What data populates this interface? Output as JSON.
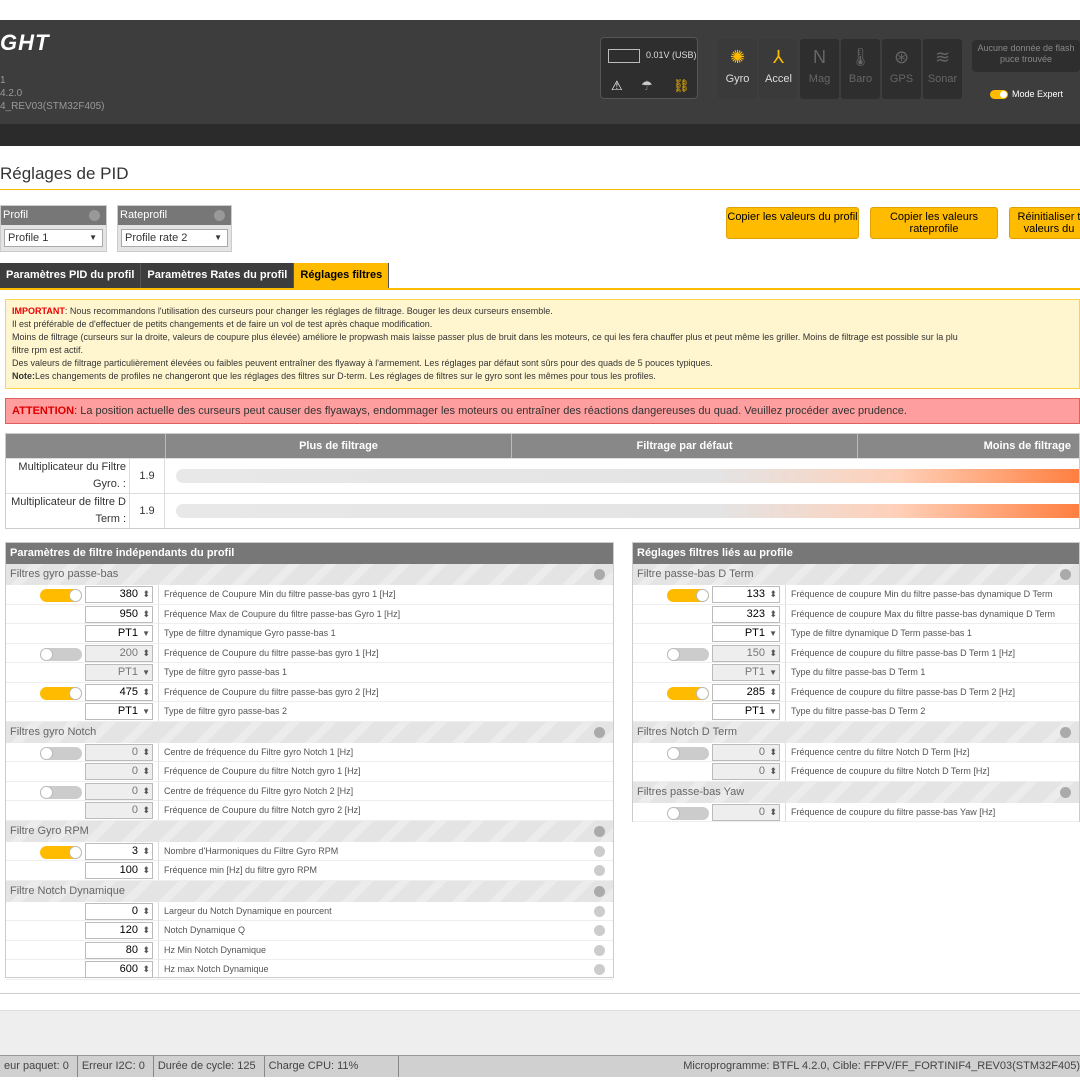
{
  "header": {
    "logo": "GHT",
    "fw_lines": [
      "1",
      "4.2.0",
      "4_REV03(STM32F405)"
    ],
    "battery_voltage": "0.01V (USB)",
    "sensors": [
      {
        "label": "Gyro",
        "icon": "gyro-icon",
        "glyph": "✺",
        "active": true
      },
      {
        "label": "Accel",
        "icon": "accel-icon",
        "glyph": "⅄",
        "active": true
      },
      {
        "label": "Mag",
        "icon": "mag-icon",
        "glyph": "N",
        "active": false
      },
      {
        "label": "Baro",
        "icon": "baro-icon",
        "glyph": "🌡",
        "active": false
      },
      {
        "label": "GPS",
        "icon": "gps-icon",
        "glyph": "⊛",
        "active": false
      },
      {
        "label": "Sonar",
        "icon": "sonar-icon",
        "glyph": "≋",
        "active": false
      }
    ],
    "flash_status": "Aucune donnée de flash puce trouvée",
    "expert_mode": "Mode Expert"
  },
  "page": {
    "title": "Réglages de PID"
  },
  "profile": {
    "label": "Profil",
    "value": "Profile 1"
  },
  "rateprofile": {
    "label": "Rateprofil",
    "value": "Profile rate 2"
  },
  "buttons": {
    "copy_profile": "Copier les valeurs du profil",
    "copy_rate": "Copier les valeurs rateprofile",
    "reset": "Réinitialiser t valeurs du"
  },
  "tabs": [
    "Paramètres PID du profil",
    "Paramètres Rates du profil",
    "Réglages filtres"
  ],
  "notice": {
    "important_label": "IMPORTANT",
    "line1": ": Nous recommandons l'utilisation des curseurs pour changer les réglages de filtrage. Bouger les deux curseurs ensemble.",
    "line2": "Il est préférable de d'effectuer de petits changements et de faire un vol de test après chaque modification.",
    "line3": "Moins de filtrage (curseurs sur la droite, valeurs de coupure plus élevée) améliore le propwash mais laisse passer plus de bruit dans les moteurs, ce qui les fera chauffer plus et peut même les griller. Moins de filtrage est possible sur la plu",
    "line4": "filtre rpm est actif.",
    "line5": "Des valeurs de filtrage particulièrement élevées ou faibles peuvent entraîner des flyaway à l'armement. Les réglages par défaut sont sûrs pour des quads de 5 pouces typiques.",
    "note_label": "Note:",
    "line6": "Les changements de profiles ne changeront que les réglages des filtres sur D-term. Les réglages de filtres sur le gyro sont les mêmes pour tous les profiles."
  },
  "warning": {
    "label": "ATTENTION",
    "text": ": La position actuelle des curseurs peut causer des flyaways, endommager les moteurs ou entraîner des réactions dangereuses du quad. Veuillez procéder avec prudence."
  },
  "sliders": {
    "headers": [
      "Plus de filtrage",
      "Filtrage par défaut",
      "Moins de filtrage"
    ],
    "rows": [
      {
        "label": "Multiplicateur du Filtre Gyro. :",
        "value": "1.9"
      },
      {
        "label": "Multiplicateur de filtre D Term :",
        "value": "1.9"
      }
    ]
  },
  "left_panel": {
    "title": "Paramètres de filtre indépendants du profil",
    "sections": [
      {
        "title": "Filtres gyro passe-bas",
        "rows": [
          {
            "switch": "on",
            "value": "380",
            "type": "num",
            "label": "Fréquence de Coupure Min du filtre passe-bas gyro 1 [Hz]"
          },
          {
            "switch": "",
            "value": "950",
            "type": "num",
            "label": "Fréquence Max de Coupure du filtre passe-bas Gyro 1 [Hz]"
          },
          {
            "switch": "",
            "value": "PT1",
            "type": "dd",
            "label": "Type de filtre dynamique Gyro passe-bas 1"
          },
          {
            "switch": "off",
            "value": "200",
            "type": "num",
            "disabled": true,
            "label": "Fréquence de Coupure du filtre passe-bas gyro 1 [Hz]"
          },
          {
            "switch": "",
            "value": "PT1",
            "type": "dd",
            "disabled": true,
            "label": "Type de filtre gyro passe-bas 1"
          },
          {
            "switch": "on",
            "value": "475",
            "type": "num",
            "label": "Fréquence de Coupure du filtre passe-bas gyro 2 [Hz]"
          },
          {
            "switch": "",
            "value": "PT1",
            "type": "dd",
            "label": "Type de filtre gyro passe-bas 2"
          }
        ]
      },
      {
        "title": "Filtres gyro Notch",
        "rows": [
          {
            "switch": "off",
            "value": "0",
            "type": "num",
            "disabled": true,
            "label": "Centre de fréquence du Filtre gyro Notch 1 [Hz]"
          },
          {
            "switch": "",
            "value": "0",
            "type": "num",
            "disabled": true,
            "label": "Fréquence de Coupure du filtre Notch gyro 1 [Hz]"
          },
          {
            "switch": "off",
            "value": "0",
            "type": "num",
            "disabled": true,
            "label": "Centre de fréquence du Filtre gyro Notch 2 [Hz]"
          },
          {
            "switch": "",
            "value": "0",
            "type": "num",
            "disabled": true,
            "label": "Fréquence de Coupure du filtre Notch gyro 2 [Hz]"
          }
        ]
      },
      {
        "title": "Filtre Gyro RPM",
        "rows": [
          {
            "switch": "on",
            "value": "3",
            "type": "num",
            "help": true,
            "label": "Nombre d'Harmoniques du Filtre Gyro RPM"
          },
          {
            "switch": "",
            "value": "100",
            "type": "num",
            "help": true,
            "label": "Fréquence min [Hz] du filtre gyro RPM"
          }
        ]
      },
      {
        "title": "Filtre Notch Dynamique",
        "rows": [
          {
            "switch": "",
            "value": "0",
            "type": "num",
            "help": true,
            "label": "Largeur du Notch Dynamique en pourcent"
          },
          {
            "switch": "",
            "value": "120",
            "type": "num",
            "help": true,
            "label": "Notch Dynamique Q"
          },
          {
            "switch": "",
            "value": "80",
            "type": "num",
            "help": true,
            "label": "Hz Min Notch Dynamique"
          },
          {
            "switch": "",
            "value": "600",
            "type": "num",
            "help": true,
            "label": "Hz max Notch Dynamique"
          }
        ]
      }
    ]
  },
  "right_panel": {
    "title": "Réglages filtres liés au profile",
    "sections": [
      {
        "title": "Filtre passe-bas D Term",
        "rows": [
          {
            "switch": "on",
            "value": "133",
            "type": "num",
            "label": "Fréquence de coupure Min du filtre passe-bas dynamique D Term"
          },
          {
            "switch": "",
            "value": "323",
            "type": "num",
            "label": "Fréquence de coupure Max du filtre passe-bas dynamique D Term"
          },
          {
            "switch": "",
            "value": "PT1",
            "type": "dd",
            "label": "Type de filtre dynamique D Term passe-bas 1"
          },
          {
            "switch": "off",
            "value": "150",
            "type": "num",
            "disabled": true,
            "label": "Fréquence de coupure du filtre passe-bas D Term 1 [Hz]"
          },
          {
            "switch": "",
            "value": "PT1",
            "type": "dd",
            "disabled": true,
            "label": "Type du filtre passe-bas D Term 1"
          },
          {
            "switch": "on",
            "value": "285",
            "type": "num",
            "label": "Fréquence de coupure du filtre passe-bas D Term 2 [Hz]"
          },
          {
            "switch": "",
            "value": "PT1",
            "type": "dd",
            "label": "Type du filtre passe-bas D Term 2"
          }
        ]
      },
      {
        "title": "Filtres Notch D Term",
        "rows": [
          {
            "switch": "off",
            "value": "0",
            "type": "num",
            "disabled": true,
            "label": "Fréquence centre du filtre Notch D Term [Hz]"
          },
          {
            "switch": "",
            "value": "0",
            "type": "num",
            "disabled": true,
            "label": "Fréquence de coupure du filtre Notch D Term [Hz]"
          }
        ]
      },
      {
        "title": "Filtres passe-bas Yaw",
        "rows": [
          {
            "switch": "off",
            "value": "0",
            "type": "num",
            "disabled": true,
            "label": "Fréquence de coupure du filtre passe-bas Yaw [Hz]"
          }
        ]
      }
    ]
  },
  "statusbar": {
    "packet_error": "eur paquet: 0",
    "i2c_error": "Erreur I2C: 0",
    "cycle": "Durée de cycle: 125",
    "cpu": "Charge CPU: 11%",
    "firmware": "Microprogramme: BTFL 4.2.0, Cible: FFPV/FF_FORTINIF4_REV03(STM32F405)"
  },
  "colors": {
    "accent": "#ffbb00",
    "header_bg": "#3d3d3d",
    "warning_bg": "#ff9e9e",
    "notice_bg": "#fff6d0"
  }
}
